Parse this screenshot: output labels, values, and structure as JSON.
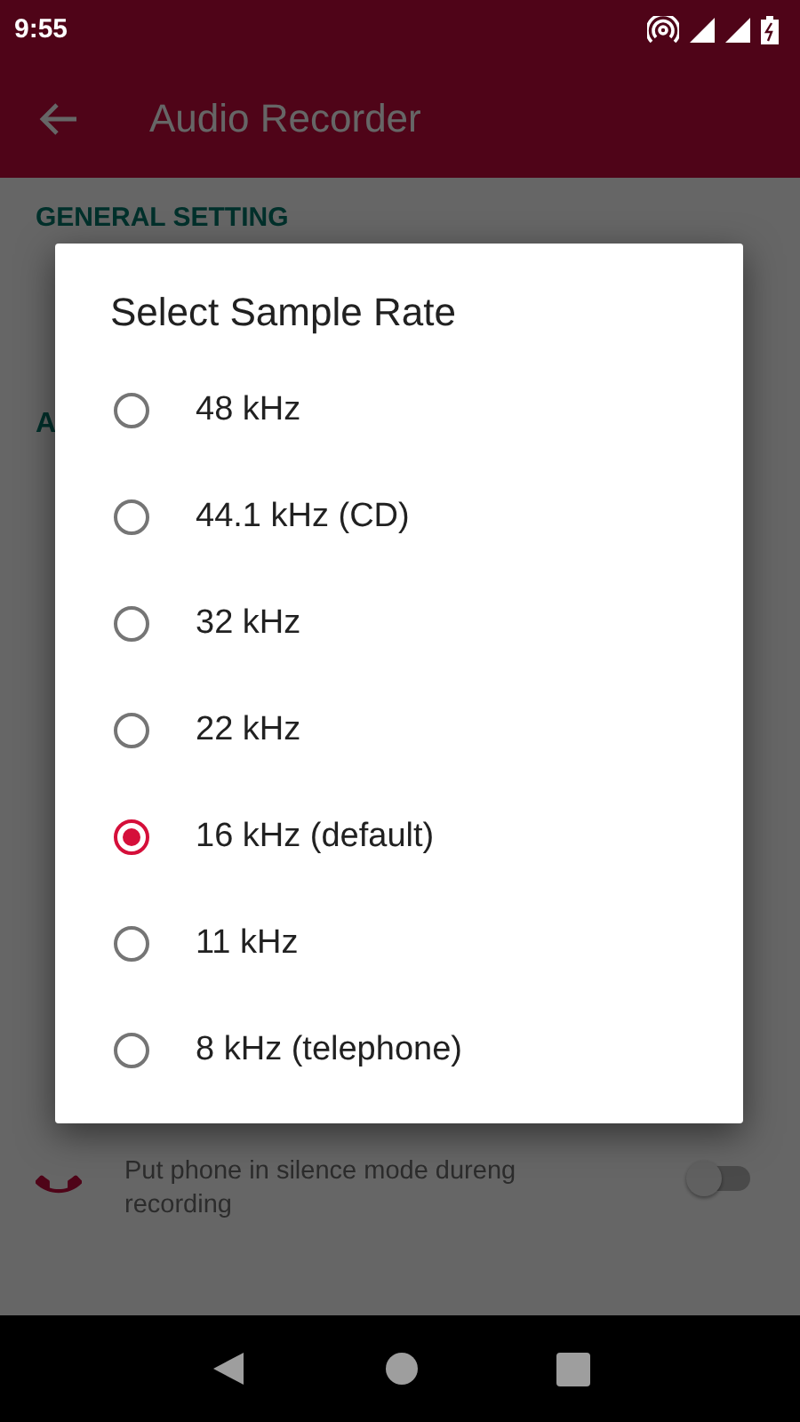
{
  "status_bar": {
    "time": "9:55"
  },
  "app_bar": {
    "title": "Audio Recorder"
  },
  "sections": [
    {
      "header": "GENERAL SETTING"
    },
    {
      "header": "A"
    }
  ],
  "setting": {
    "description": "Put phone in silence mode dureng recording",
    "on": false
  },
  "dialog": {
    "title": "Select Sample Rate",
    "options": [
      {
        "label": "48 kHz",
        "selected": false
      },
      {
        "label": "44.1 kHz (CD)",
        "selected": false
      },
      {
        "label": "32 kHz",
        "selected": false
      },
      {
        "label": "22 kHz",
        "selected": false
      },
      {
        "label": "16 kHz (default)",
        "selected": true
      },
      {
        "label": "11 kHz",
        "selected": false
      },
      {
        "label": "8 kHz (telephone)",
        "selected": false
      }
    ]
  }
}
